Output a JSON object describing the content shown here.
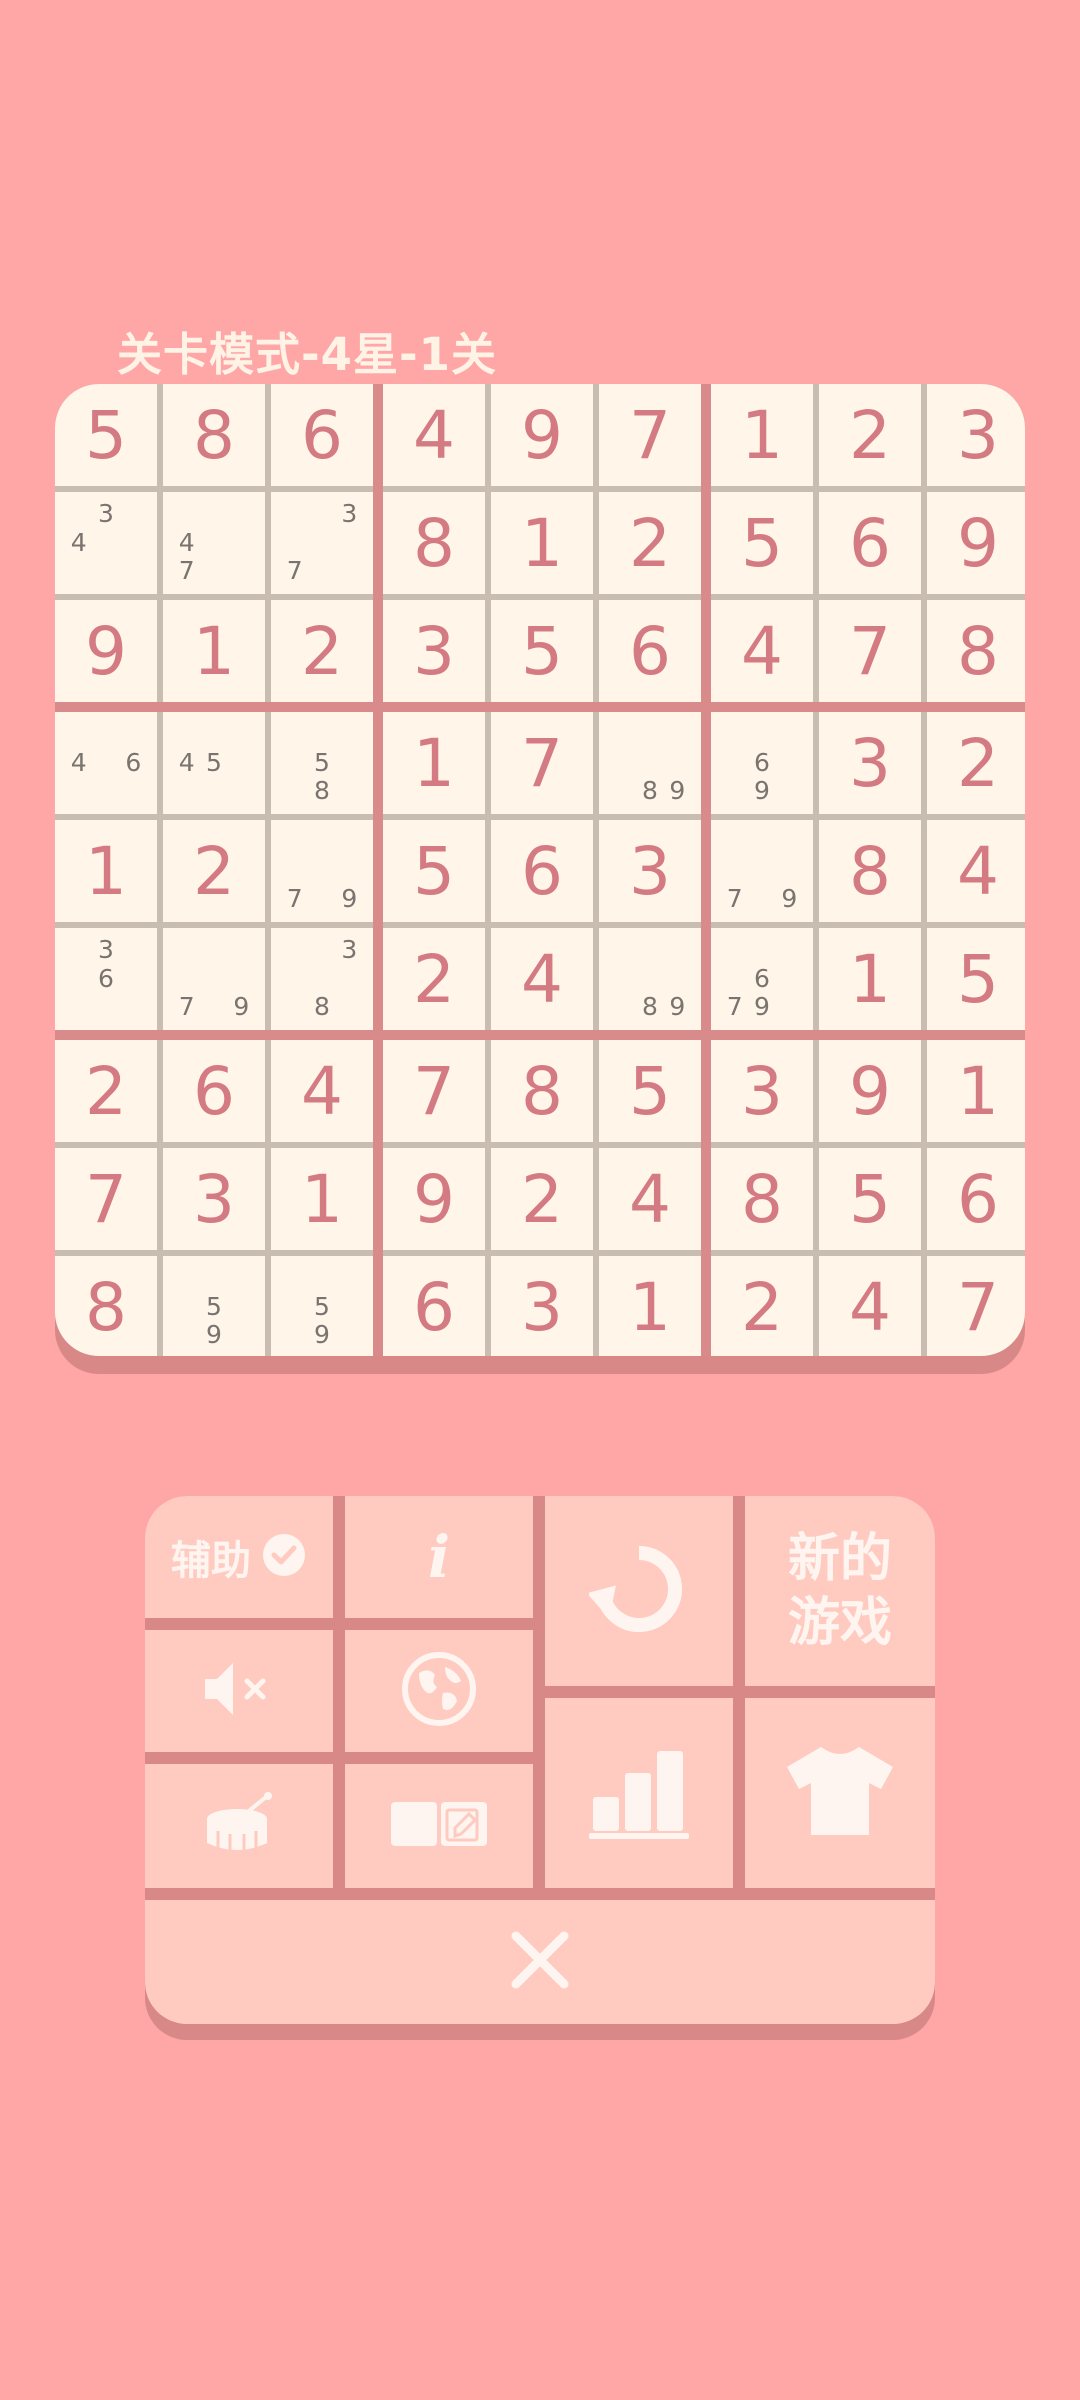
{
  "title": "关卡模式-4星-1关",
  "board": [
    [
      {
        "v": "5"
      },
      {
        "v": "8"
      },
      {
        "v": "6"
      },
      {
        "v": "4"
      },
      {
        "v": "9"
      },
      {
        "v": "7"
      },
      {
        "v": "1"
      },
      {
        "v": "2"
      },
      {
        "v": "3"
      }
    ],
    [
      {
        "n": [
          "",
          "3",
          "",
          "4",
          "",
          "",
          "",
          "",
          ""
        ]
      },
      {
        "n": [
          "",
          "",
          "",
          "4",
          "",
          "",
          "7",
          "",
          ""
        ]
      },
      {
        "n": [
          "",
          "",
          "3",
          "",
          "",
          "",
          "7",
          "",
          ""
        ]
      },
      {
        "v": "8"
      },
      {
        "v": "1"
      },
      {
        "v": "2"
      },
      {
        "v": "5"
      },
      {
        "v": "6"
      },
      {
        "v": "9"
      }
    ],
    [
      {
        "v": "9"
      },
      {
        "v": "1"
      },
      {
        "v": "2"
      },
      {
        "v": "3"
      },
      {
        "v": "5"
      },
      {
        "v": "6"
      },
      {
        "v": "4"
      },
      {
        "v": "7"
      },
      {
        "v": "8"
      }
    ],
    [
      {
        "n": [
          "",
          "",
          "",
          "4",
          "",
          "6",
          "",
          "",
          ""
        ]
      },
      {
        "n": [
          "",
          "",
          "",
          "4",
          "5",
          "",
          "",
          "",
          ""
        ]
      },
      {
        "n": [
          "",
          "",
          "",
          "",
          "5",
          "",
          "",
          "8",
          ""
        ]
      },
      {
        "v": "1"
      },
      {
        "v": "7"
      },
      {
        "n": [
          "",
          "",
          "",
          "",
          "",
          "",
          "",
          "8",
          "9"
        ]
      },
      {
        "n": [
          "",
          "",
          "",
          "",
          "6",
          "",
          "",
          "9",
          ""
        ]
      },
      {
        "v": "3"
      },
      {
        "v": "2"
      }
    ],
    [
      {
        "v": "1"
      },
      {
        "v": "2"
      },
      {
        "n": [
          "",
          "",
          "",
          "",
          "",
          "",
          "7",
          "",
          "9"
        ]
      },
      {
        "v": "5"
      },
      {
        "v": "6"
      },
      {
        "v": "3"
      },
      {
        "n": [
          "",
          "",
          "",
          "",
          "",
          "",
          "7",
          "",
          "9"
        ]
      },
      {
        "v": "8"
      },
      {
        "v": "4"
      }
    ],
    [
      {
        "n": [
          "",
          "3",
          "",
          "",
          "6",
          "",
          "",
          "",
          ""
        ]
      },
      {
        "n": [
          "",
          "",
          "",
          "",
          "",
          "",
          "7",
          "",
          "9"
        ]
      },
      {
        "n": [
          "",
          "",
          "3",
          "",
          "",
          "",
          "",
          "8",
          ""
        ]
      },
      {
        "v": "2"
      },
      {
        "v": "4"
      },
      {
        "n": [
          "",
          "",
          "",
          "",
          "",
          "",
          "",
          "8",
          "9"
        ]
      },
      {
        "n": [
          "",
          "",
          "",
          "",
          "6",
          "",
          "7",
          "9",
          ""
        ]
      },
      {
        "v": "1"
      },
      {
        "v": "5"
      }
    ],
    [
      {
        "v": "2"
      },
      {
        "v": "6"
      },
      {
        "v": "4"
      },
      {
        "v": "7"
      },
      {
        "v": "8"
      },
      {
        "v": "5"
      },
      {
        "v": "3"
      },
      {
        "v": "9"
      },
      {
        "v": "1"
      }
    ],
    [
      {
        "v": "7"
      },
      {
        "v": "3"
      },
      {
        "v": "1"
      },
      {
        "v": "9"
      },
      {
        "v": "2"
      },
      {
        "v": "4"
      },
      {
        "v": "8"
      },
      {
        "v": "5"
      },
      {
        "v": "6"
      }
    ],
    [
      {
        "v": "8"
      },
      {
        "n": [
          "",
          "",
          "",
          "",
          "5",
          "",
          "",
          "9",
          ""
        ]
      },
      {
        "n": [
          "",
          "",
          "",
          "",
          "5",
          "",
          "",
          "9",
          ""
        ]
      },
      {
        "v": "6"
      },
      {
        "v": "3"
      },
      {
        "v": "1"
      },
      {
        "v": "2"
      },
      {
        "v": "4"
      },
      {
        "v": "7"
      }
    ]
  ],
  "controls": {
    "assist_label": "辅助",
    "info_label": "i",
    "new_game_line1": "新的",
    "new_game_line2": "游戏",
    "icons": {
      "assist": "check-circle-icon",
      "restart": "restart-icon",
      "mute": "speaker-muted-icon",
      "language": "globe-icon",
      "stats": "bar-chart-icon",
      "theme": "tshirt-icon",
      "drum": "drum-icon",
      "notes": "notes-toggle-icon",
      "close": "close-icon"
    }
  },
  "colors": {
    "background": "#FFA6A6",
    "board_border": "#D98A8A",
    "cell": "#FFF6E9",
    "given_digit": "#D47A82",
    "note_digit": "#7A7470",
    "button": "#FFCBC0",
    "button_icon": "#FFF5F0"
  }
}
